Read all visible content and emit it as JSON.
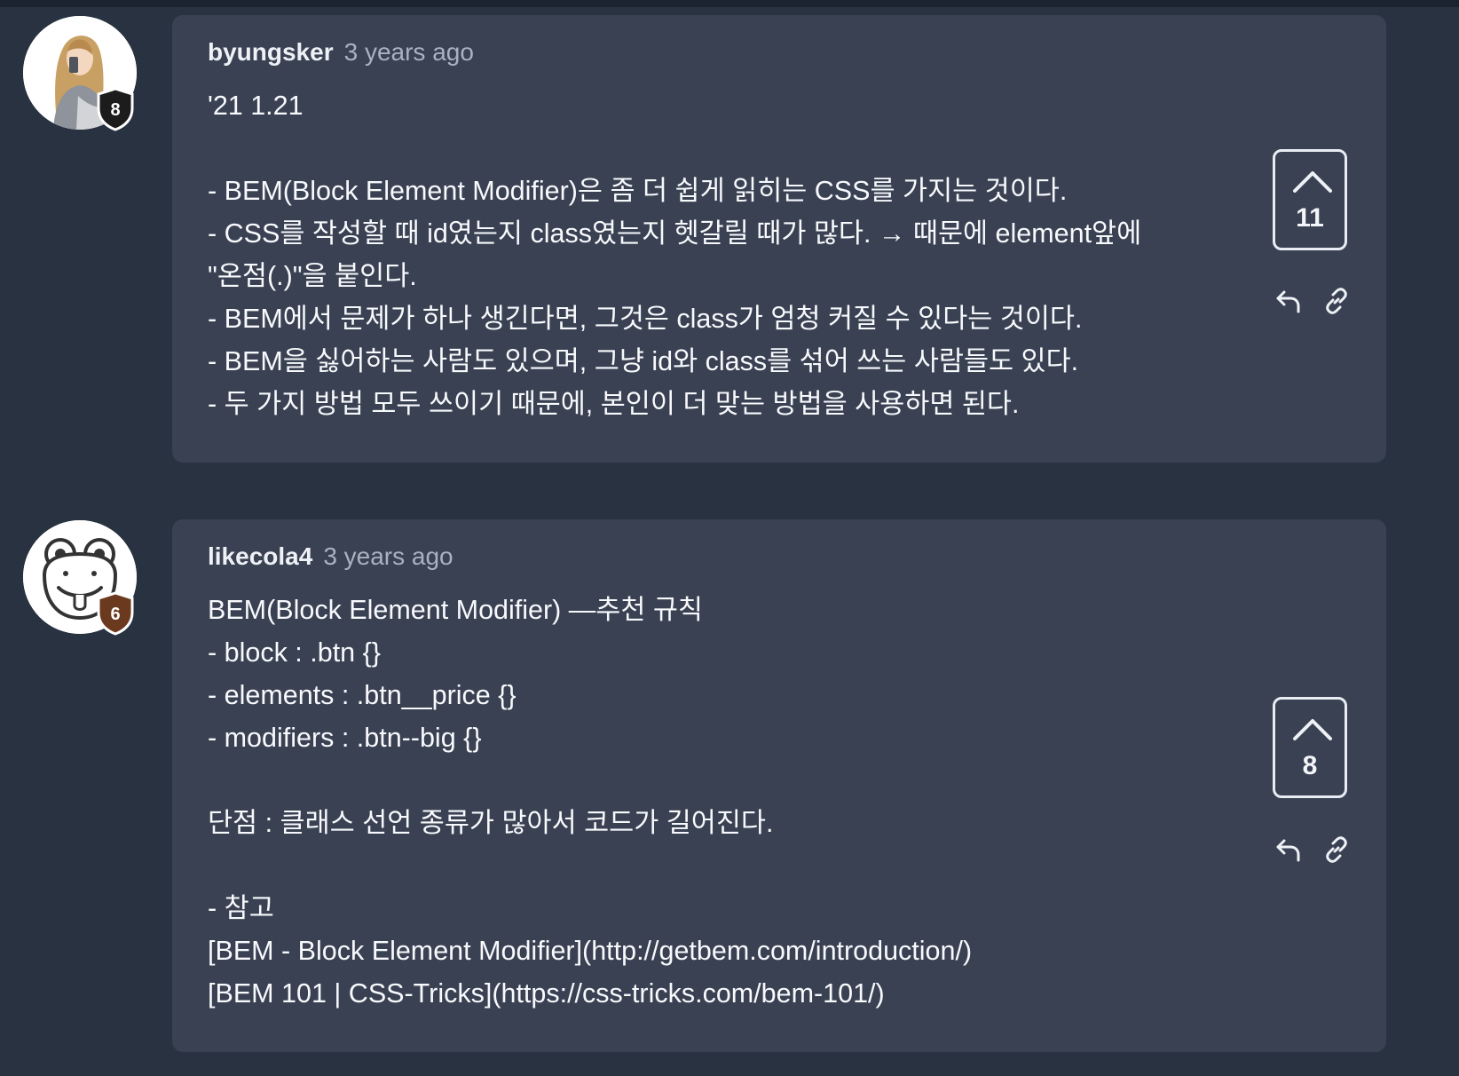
{
  "comments": [
    {
      "author": "byungsker",
      "timestamp": "3 years ago",
      "badge_level": "8",
      "badge_color": "#1c1c1c",
      "votes": "11",
      "body_lines": [
        "'21 1.21",
        "",
        "- BEM(Block Element Modifier)은 좀 더 쉽게 읽히는 CSS를 가지는 것이다.",
        "- CSS를 작성할 때 id였는지 class였는지 헷갈릴 때가 많다. → 때문에 element앞에",
        "\"온점(.)\"을 붙인다.",
        "- BEM에서 문제가 하나 생긴다면, 그것은 class가 엄청 커질 수 있다는 것이다.",
        "- BEM을 싫어하는 사람도 있으며, 그냥 id와 class를 섞어 쓰는 사람들도 있다.",
        "- 두 가지 방법 모두 쓰이기 때문에, 본인이 더 맞는 방법을 사용하면 된다."
      ]
    },
    {
      "author": "likecola4",
      "timestamp": "3 years ago",
      "badge_level": "6",
      "badge_color": "#6b3a1e",
      "votes": "8",
      "body_lines": [
        "BEM(Block Element Modifier) —추천 규칙",
        "- block : .btn {}",
        "- elements : .btn__price {}",
        "- modifiers : .btn--big {}",
        "",
        "단점 : 클래스 선언 종류가 많아서 코드가 길어진다.",
        "",
        "- 참고",
        "[BEM - Block Element Modifier](http://getbem.com/introduction/)",
        "[BEM 101 | CSS-Tricks](https://css-tricks.com/bem-101/)"
      ]
    }
  ],
  "icons": {
    "upvote": "chevron-up-icon",
    "reply": "reply-arrow-icon",
    "link": "chain-link-icon",
    "badge": "shield-badge-icon"
  }
}
